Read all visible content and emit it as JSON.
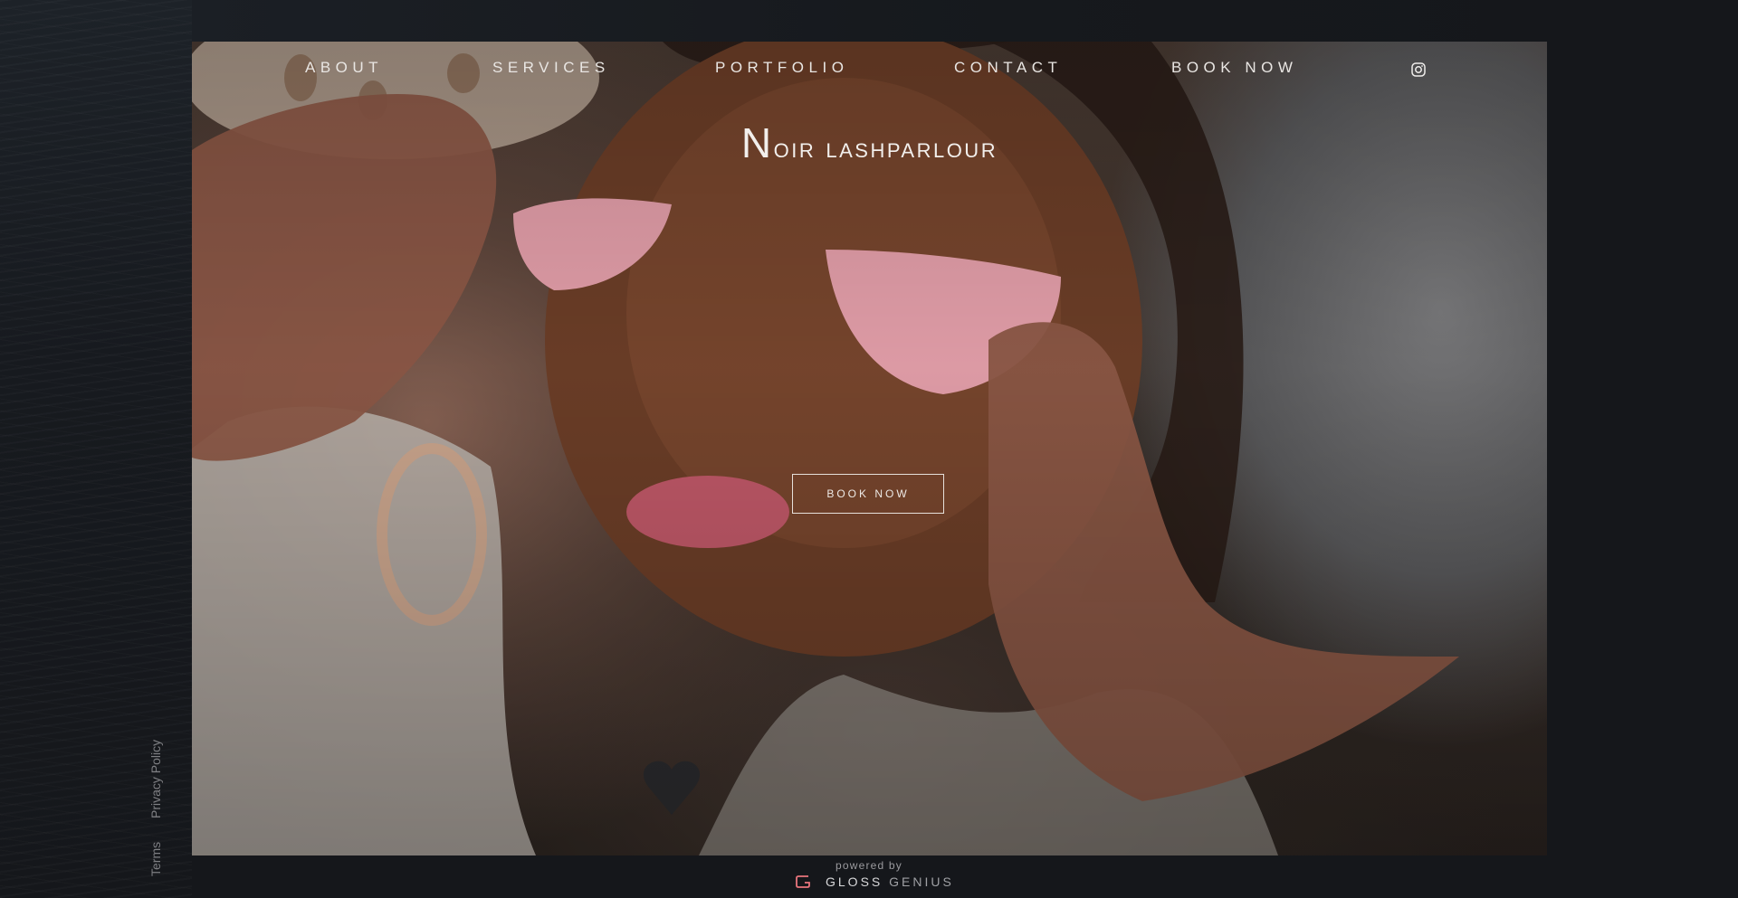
{
  "nav": {
    "items": [
      {
        "label": "ABOUT"
      },
      {
        "label": "SERVICES"
      },
      {
        "label": "PORTFOLIO"
      },
      {
        "label": "CONTACT"
      },
      {
        "label": "BOOK NOW"
      }
    ],
    "instagram_icon": "instagram-icon"
  },
  "hero": {
    "brand_first": "N",
    "brand_rest": "oir lashparlour",
    "cta_label": "BOOK NOW",
    "image_description_icon": "photo"
  },
  "side_links": {
    "privacy": "Privacy Policy",
    "terms": "Terms"
  },
  "footer": {
    "powered_by": "powered by",
    "brand_bold": "GLOSS",
    "brand_light": "GENIUS"
  },
  "colors": {
    "background": "#15171b",
    "text": "#e9e6e3",
    "accent_logo": "#e8757d"
  }
}
